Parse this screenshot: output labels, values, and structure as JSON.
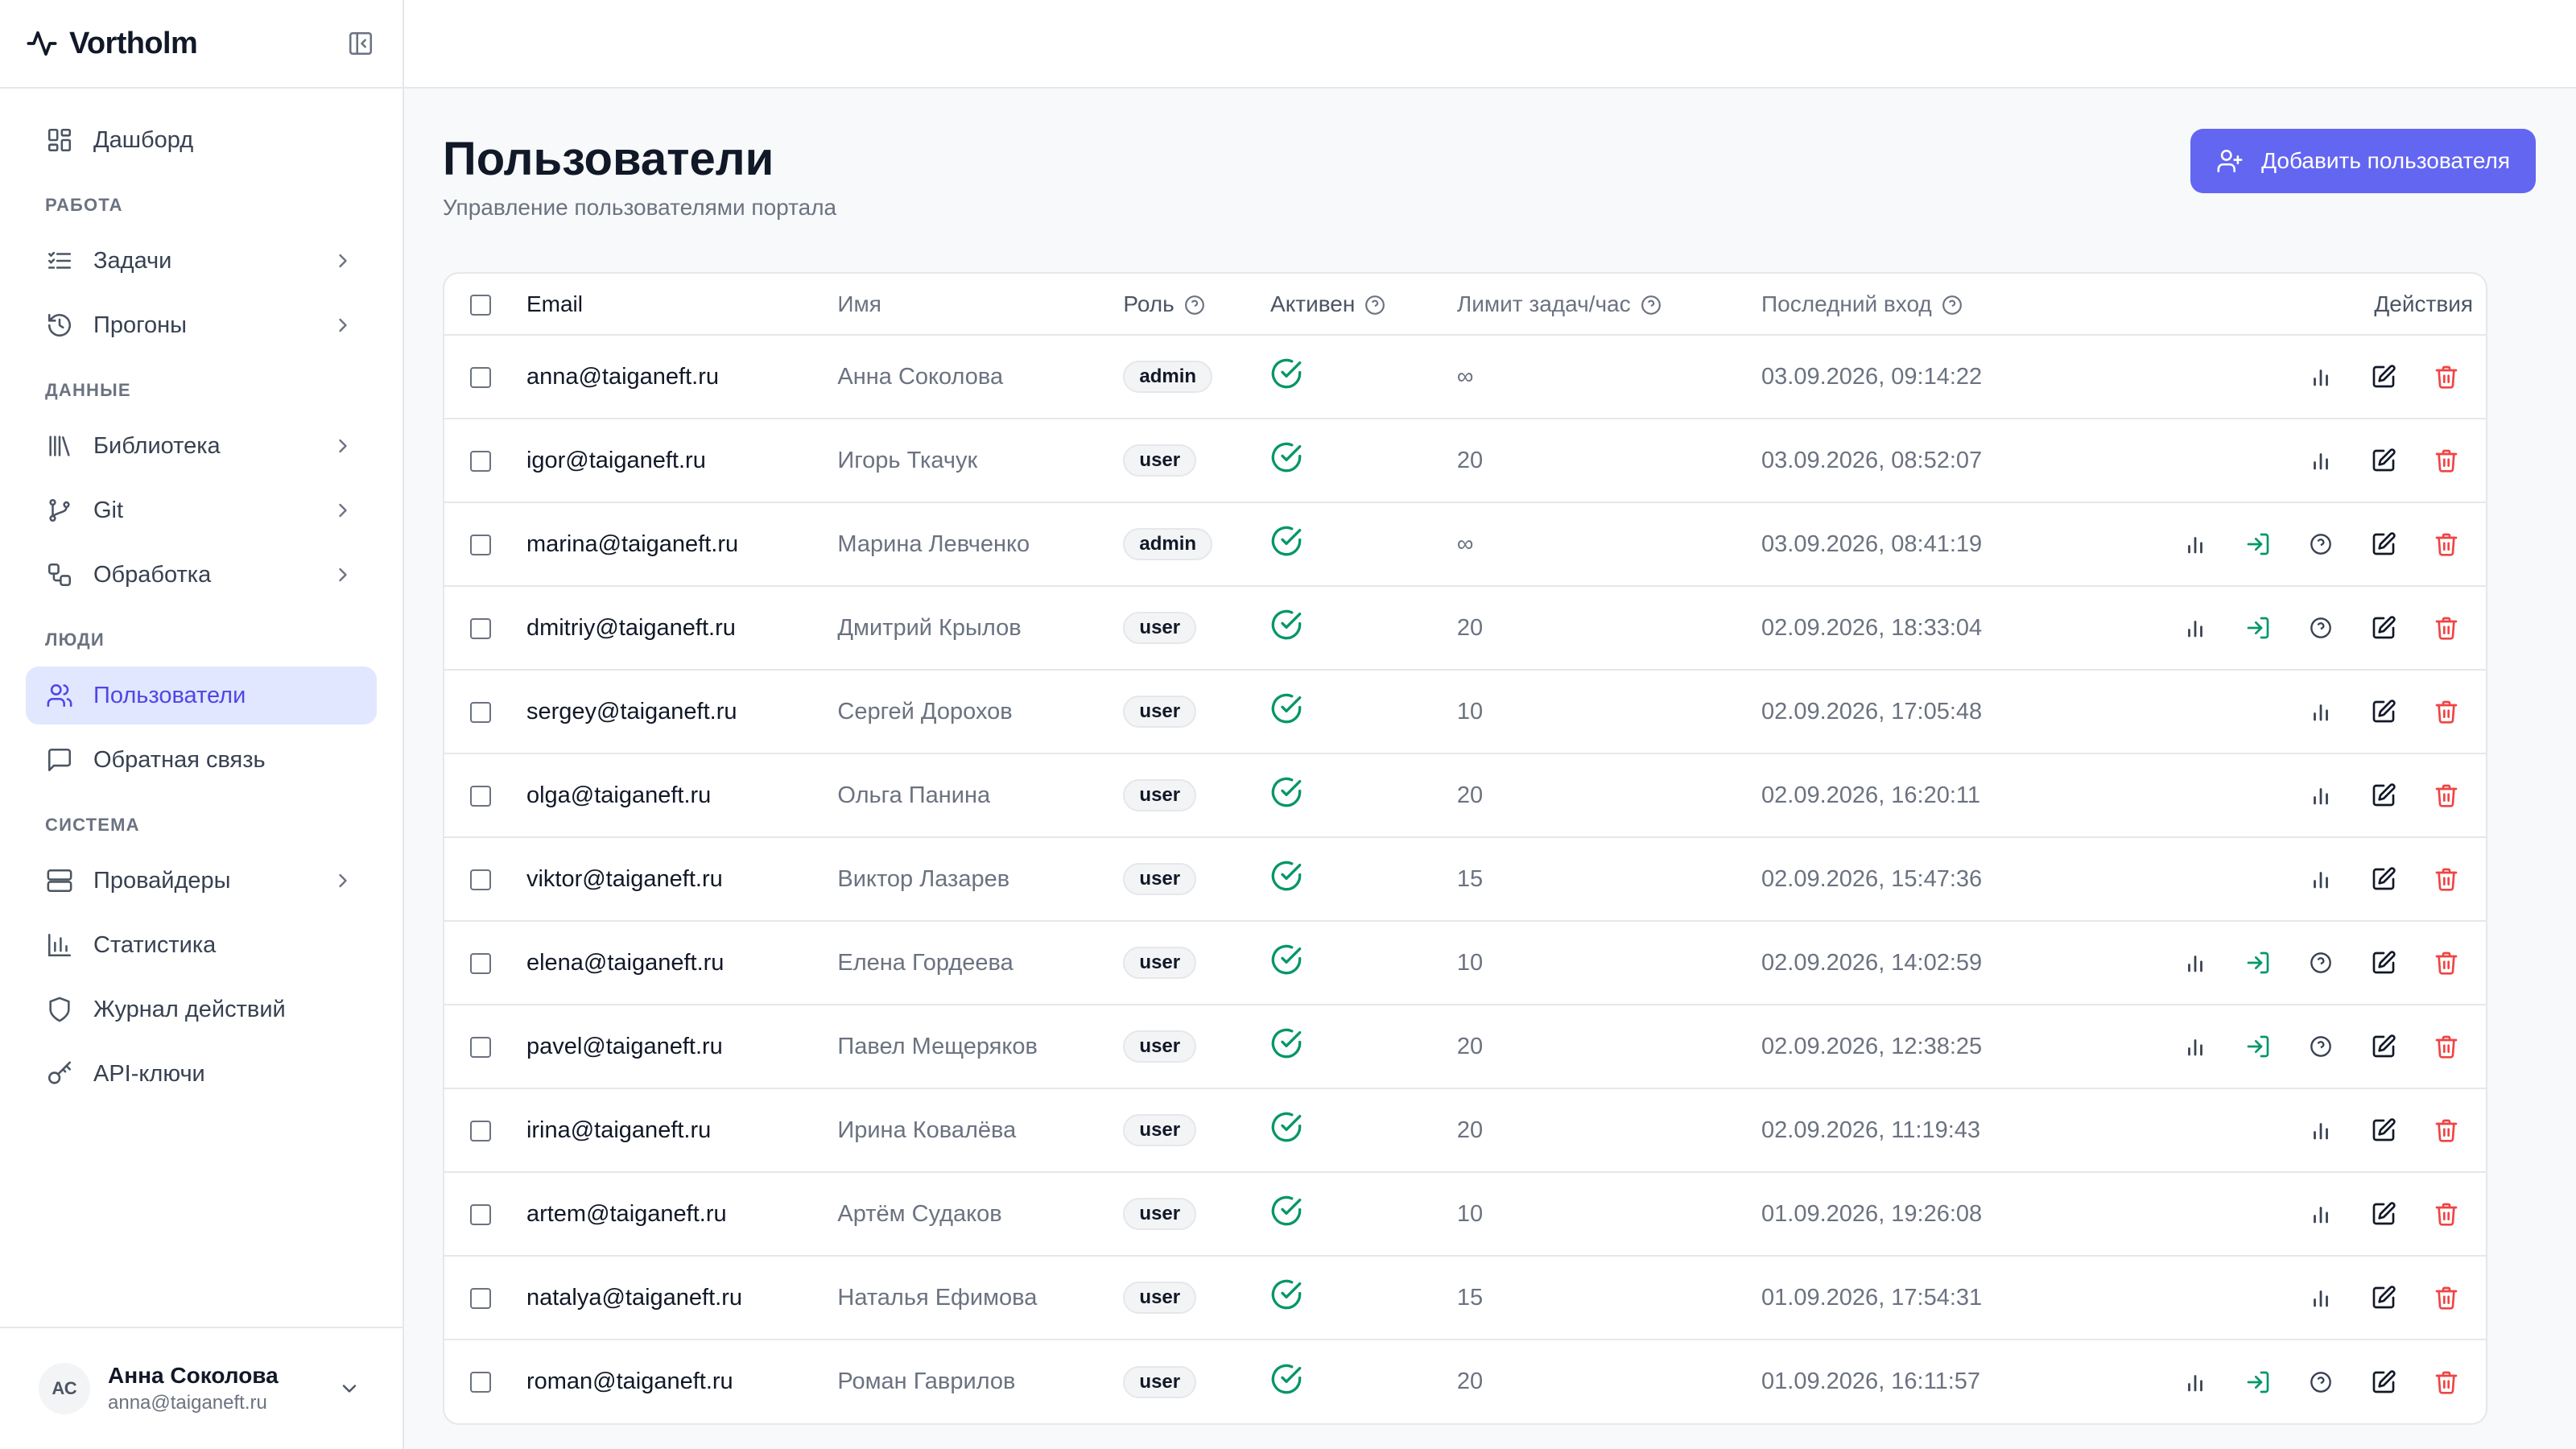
{
  "brand": {
    "name": "Vortholm"
  },
  "sidebar": {
    "top": {
      "label": "Дашборд",
      "icon": "dashboard-icon"
    },
    "sections": [
      {
        "title": "РАБОТА",
        "items": [
          {
            "label": "Задачи",
            "icon": "tasks-icon",
            "chevron": true
          },
          {
            "label": "Прогоны",
            "icon": "history-icon",
            "chevron": true
          }
        ]
      },
      {
        "title": "ДАННЫЕ",
        "items": [
          {
            "label": "Библиотека",
            "icon": "library-icon",
            "chevron": true
          },
          {
            "label": "Git",
            "icon": "git-branch-icon",
            "chevron": true
          },
          {
            "label": "Обработка",
            "icon": "workflow-icon",
            "chevron": true
          }
        ]
      },
      {
        "title": "ЛЮДИ",
        "items": [
          {
            "label": "Пользователи",
            "icon": "users-icon",
            "active": true
          },
          {
            "label": "Обратная связь",
            "icon": "message-icon"
          }
        ]
      },
      {
        "title": "СИСТЕМА",
        "items": [
          {
            "label": "Провайдеры",
            "icon": "server-icon",
            "chevron": true
          },
          {
            "label": "Статистика",
            "icon": "chart-icon"
          },
          {
            "label": "Журнал действий",
            "icon": "shield-icon"
          },
          {
            "label": "API-ключи",
            "icon": "key-icon"
          }
        ]
      }
    ],
    "user": {
      "initials": "АС",
      "name": "Анна Соколова",
      "email": "anna@taiganeft.ru"
    }
  },
  "page": {
    "title": "Пользователи",
    "subtitle": "Управление пользователями портала",
    "add_button": "Добавить пользователя"
  },
  "colors": {
    "accent": "#6366f1",
    "active_bg": "#e0e7ff",
    "success": "#059669",
    "danger": "#ef4444"
  },
  "table": {
    "headers": {
      "email": "Email",
      "name": "Имя",
      "role": "Роль",
      "active": "Активен",
      "limit": "Лимит задач/час",
      "last_login": "Последний вход",
      "actions": "Действия"
    },
    "rows": [
      {
        "email": "anna@taiganeft.ru",
        "name": "Анна Соколова",
        "role": "admin",
        "limit": "∞",
        "last": "03.09.2026, 09:14:22",
        "extra": false
      },
      {
        "email": "igor@taiganeft.ru",
        "name": "Игорь Ткачук",
        "role": "user",
        "limit": "20",
        "last": "03.09.2026, 08:52:07",
        "extra": false
      },
      {
        "email": "marina@taiganeft.ru",
        "name": "Марина Левченко",
        "role": "admin",
        "limit": "∞",
        "last": "03.09.2026, 08:41:19",
        "extra": true
      },
      {
        "email": "dmitriy@taiganeft.ru",
        "name": "Дмитрий Крылов",
        "role": "user",
        "limit": "20",
        "last": "02.09.2026, 18:33:04",
        "extra": true
      },
      {
        "email": "sergey@taiganeft.ru",
        "name": "Сергей Дорохов",
        "role": "user",
        "limit": "10",
        "last": "02.09.2026, 17:05:48",
        "extra": false
      },
      {
        "email": "olga@taiganeft.ru",
        "name": "Ольга Панина",
        "role": "user",
        "limit": "20",
        "last": "02.09.2026, 16:20:11",
        "extra": false
      },
      {
        "email": "viktor@taiganeft.ru",
        "name": "Виктор Лазарев",
        "role": "user",
        "limit": "15",
        "last": "02.09.2026, 15:47:36",
        "extra": false
      },
      {
        "email": "elena@taiganeft.ru",
        "name": "Елена Гордеева",
        "role": "user",
        "limit": "10",
        "last": "02.09.2026, 14:02:59",
        "extra": true
      },
      {
        "email": "pavel@taiganeft.ru",
        "name": "Павел Мещеряков",
        "role": "user",
        "limit": "20",
        "last": "02.09.2026, 12:38:25",
        "extra": true
      },
      {
        "email": "irina@taiganeft.ru",
        "name": "Ирина Ковалёва",
        "role": "user",
        "limit": "20",
        "last": "02.09.2026, 11:19:43",
        "extra": false
      },
      {
        "email": "artem@taiganeft.ru",
        "name": "Артём Судаков",
        "role": "user",
        "limit": "10",
        "last": "01.09.2026, 19:26:08",
        "extra": false
      },
      {
        "email": "natalya@taiganeft.ru",
        "name": "Наталья Ефимова",
        "role": "user",
        "limit": "15",
        "last": "01.09.2026, 17:54:31",
        "extra": false
      },
      {
        "email": "roman@taiganeft.ru",
        "name": "Роман Гаврилов",
        "role": "user",
        "limit": "20",
        "last": "01.09.2026, 16:11:57",
        "extra": true
      }
    ]
  }
}
